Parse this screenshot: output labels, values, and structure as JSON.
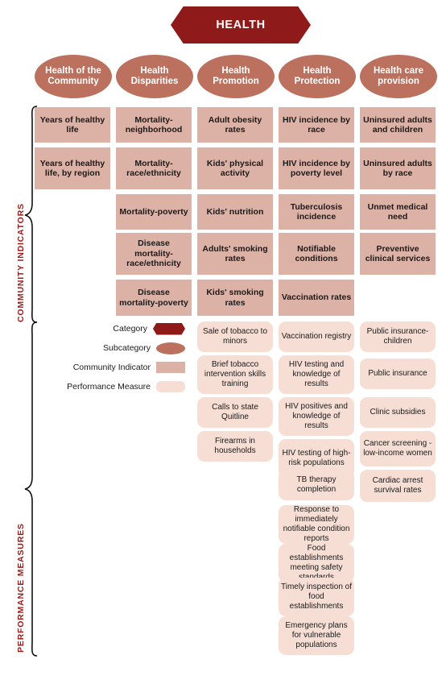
{
  "category": {
    "label": "HEALTH"
  },
  "section_labels": {
    "community_indicators": "COMMUNITY INDICATORS",
    "performance_measures": "PERFORMANCE MEASURES"
  },
  "colors": {
    "category": "#8E1A1A",
    "subcategory": "#BC705E",
    "community_indicator": "#DDB2A6",
    "performance_measure": "#F6DED4",
    "section_label": "#9B1B1B",
    "category_text": "#FFFFFF"
  },
  "legend": {
    "items": [
      {
        "label": "Category",
        "shape": "hexagon",
        "color": "#8E1A1A"
      },
      {
        "label": "Subcategory",
        "shape": "ellipse",
        "color": "#BC705E"
      },
      {
        "label": "Community Indicator",
        "shape": "rectangle",
        "color": "#DDB2A6"
      },
      {
        "label": "Performance Measure",
        "shape": "rounded-rectangle",
        "color": "#F6DED4"
      }
    ]
  },
  "columns": [
    {
      "subcategory": "Health of the Community",
      "community_indicators": [
        "Years of healthy life",
        "Years of healthy life, by region"
      ],
      "performance_measures": []
    },
    {
      "subcategory": "Health Disparities",
      "community_indicators": [
        "Mortality-neighborhood",
        "Mortality-race/ethnicity",
        "Mortality-poverty",
        "Disease mortality-race/ethnicity",
        "Disease mortality-poverty"
      ],
      "performance_measures": []
    },
    {
      "subcategory": "Health Promotion",
      "community_indicators": [
        "Adult obesity rates",
        "Kids' physical activity",
        "Kids' nutrition",
        "Adults' smoking rates",
        "Kids' smoking rates"
      ],
      "performance_measures": [
        "Sale of tobacco to minors",
        "Brief tobacco intervention skills training",
        "Calls to state Quitline",
        "Firearms in households"
      ]
    },
    {
      "subcategory": "Health Protection",
      "community_indicators": [
        "HIV incidence by race",
        "HIV incidence by poverty level",
        "Tuberculosis incidence",
        "Notifiable conditions",
        "Vaccination rates"
      ],
      "performance_measures": [
        "Vaccination registry",
        "HIV testing and knowledge of results",
        "HIV positives and knowledge of results",
        "HIV testing of high-risk populations",
        "TB therapy completion",
        "Response to immediately notifiable condition reports",
        "Food establishments meeting safety standards",
        "Timely inspection of food establishments",
        "Emergency plans for vulnerable populations"
      ]
    },
    {
      "subcategory": "Health care provision",
      "community_indicators": [
        "Uninsured adults and children",
        "Uninsured adults by race",
        "Unmet medical need",
        "Preventive clinical services"
      ],
      "performance_measures": [
        "Public insurance-children",
        "Public insurance",
        "Clinic subsidies",
        "Cancer screening - low-income women",
        "Cardiac arrest survival rates"
      ]
    }
  ]
}
